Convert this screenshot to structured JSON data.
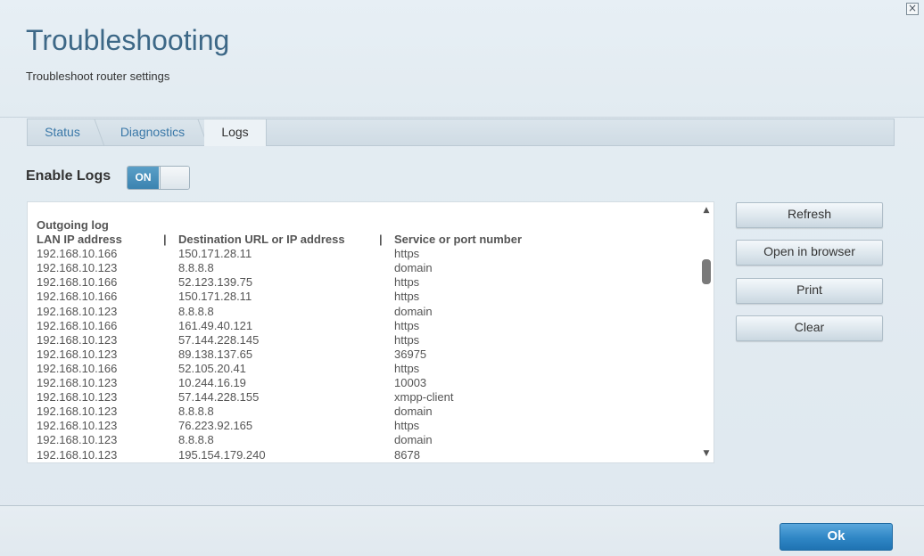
{
  "window": {
    "close_glyph": "×"
  },
  "header": {
    "title": "Troubleshooting",
    "subtitle": "Troubleshoot router settings"
  },
  "tabs": [
    {
      "label": "Status",
      "active": false
    },
    {
      "label": "Diagnostics",
      "active": false
    },
    {
      "label": "Logs",
      "active": true
    }
  ],
  "logs_toggle": {
    "label": "Enable Logs",
    "state": "ON"
  },
  "log": {
    "title": "Outgoing log",
    "columns": [
      "LAN IP address",
      "Destination URL or IP address",
      "Service or port number"
    ],
    "separator": "|",
    "rows": [
      [
        "192.168.10.166",
        "150.171.28.11",
        "https"
      ],
      [
        "192.168.10.123",
        "8.8.8.8",
        "domain"
      ],
      [
        "192.168.10.166",
        "52.123.139.75",
        "https"
      ],
      [
        "192.168.10.166",
        "150.171.28.11",
        "https"
      ],
      [
        "192.168.10.123",
        "8.8.8.8",
        "domain"
      ],
      [
        "192.168.10.166",
        "161.49.40.121",
        "https"
      ],
      [
        "192.168.10.123",
        "57.144.228.145",
        "https"
      ],
      [
        "192.168.10.123",
        "89.138.137.65",
        "36975"
      ],
      [
        "192.168.10.166",
        "52.105.20.41",
        "https"
      ],
      [
        "192.168.10.123",
        "10.244.16.19",
        "10003"
      ],
      [
        "192.168.10.123",
        "57.144.228.155",
        "xmpp-client"
      ],
      [
        "192.168.10.123",
        "8.8.8.8",
        "domain"
      ],
      [
        "192.168.10.123",
        "76.223.92.165",
        "https"
      ],
      [
        "192.168.10.123",
        "8.8.8.8",
        "domain"
      ],
      [
        "192.168.10.123",
        "195.154.179.240",
        "8678"
      ]
    ],
    "scroll_up_glyph": "▲",
    "scroll_down_glyph": "▼"
  },
  "actions": {
    "refresh": "Refresh",
    "open_in_browser": "Open in browser",
    "print": "Print",
    "clear": "Clear"
  },
  "footer": {
    "ok": "Ok"
  },
  "colors": {
    "accent": "#3d6887",
    "tab_link": "#3a78a8",
    "ok_button": "#2f86c5"
  }
}
